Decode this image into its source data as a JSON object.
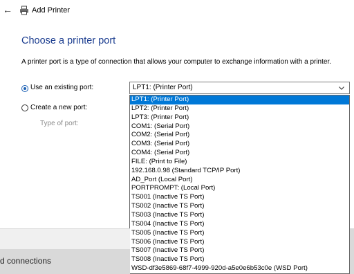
{
  "window": {
    "title": "Add Printer"
  },
  "icons": {
    "back": "back-arrow-icon",
    "printer": "printer-icon",
    "chevron": "chevron-down-icon"
  },
  "main": {
    "heading": "Choose a printer port",
    "description": "A printer port is a type of connection that allows your computer to exchange information with a printer."
  },
  "port_options": {
    "existing_label": "Use an existing port:",
    "existing_selected": true,
    "new_label": "Create a new port:",
    "new_selected": false,
    "type_label": "Type of port:"
  },
  "port_select": {
    "value": "LPT1: (Printer Port)",
    "options": [
      "LPT1: (Printer Port)",
      "LPT2: (Printer Port)",
      "LPT3: (Printer Port)",
      "COM1: (Serial Port)",
      "COM2: (Serial Port)",
      "COM3: (Serial Port)",
      "COM4: (Serial Port)",
      "FILE: (Print to File)",
      "192.168.0.98 (Standard TCP/IP Port)",
      "AD_Port (Local Port)",
      "PORTPROMPT: (Local Port)",
      "TS001 (Inactive TS Port)",
      "TS002 (Inactive TS Port)",
      "TS003 (Inactive TS Port)",
      "TS004 (Inactive TS Port)",
      "TS005 (Inactive TS Port)",
      "TS006 (Inactive TS Port)",
      "TS007 (Inactive TS Port)",
      "TS008 (Inactive TS Port)",
      "WSD-df3e5869-68f7-4999-920d-a5e0e6b53c0e (WSD Port)"
    ],
    "highlighted_index": 0
  },
  "background": {
    "bottom_text": "d connections"
  },
  "colors": {
    "heading": "#1a3c8f",
    "highlight": "#0078d7",
    "radio": "#1a5fb4"
  }
}
